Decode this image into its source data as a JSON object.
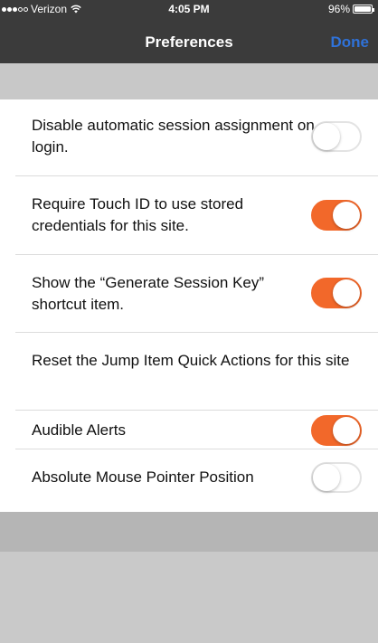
{
  "status_bar": {
    "carrier": "Verizon",
    "time": "4:05 PM",
    "battery": "96%",
    "signal_bars_filled": 3,
    "signal_bars_total": 5,
    "battery_level_percent": 96
  },
  "nav": {
    "title": "Preferences",
    "done_label": "Done"
  },
  "preferences": [
    {
      "label": "Disable automatic session assignment on login.",
      "enabled": false
    },
    {
      "label": "Require Touch ID to use stored credentials for this site.",
      "enabled": true
    },
    {
      "label": "Show the “Generate Session Key” shortcut item.",
      "enabled": true
    },
    {
      "label": "Reset the Jump Item Quick Actions for this site"
    },
    {
      "label": "Audible Alerts",
      "enabled": true
    },
    {
      "label": "Absolute Mouse Pointer Position",
      "enabled": false
    }
  ],
  "colors": {
    "accent_toggle_on": "#f2682a",
    "nav_background": "#3b3b3b",
    "done_link": "#2f72d9"
  }
}
